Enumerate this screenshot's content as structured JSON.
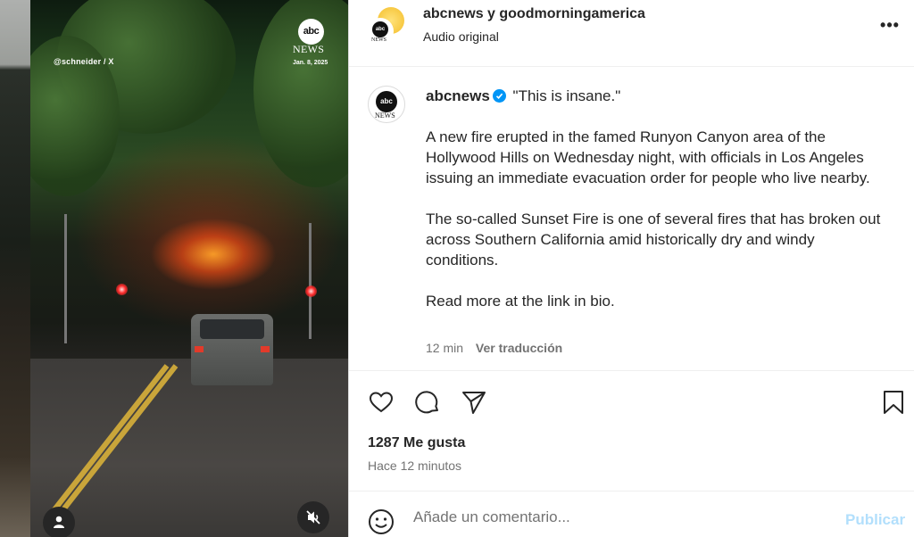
{
  "media": {
    "credit": "@schneider / X",
    "logo_abc": "abc",
    "logo_news": "NEWS",
    "date": "Jan. 8, 2025",
    "avatar_icon": "user-icon",
    "mute_icon": "mute-icon"
  },
  "header": {
    "logo_abc": "abc",
    "logo_news": "NEWS",
    "users": "abcnews y goodmorningamerica",
    "audio": "Audio original",
    "more": "•••",
    "more_icon": "more-options-icon"
  },
  "caption": {
    "logo_abc": "abc",
    "logo_news": "NEWS",
    "username": "abcnews",
    "verified_icon": "verified-badge-icon",
    "headline": "\"This is insane.\"",
    "paragraph1": "A new fire erupted in the famed Runyon Canyon area of the Hollywood Hills on Wednesday night, with officials in Los Angeles issuing an immediate evacuation order for people who live nearby.",
    "paragraph2": "The so-called Sunset Fire is one of several fires that has broken out across Southern California amid historically dry and windy conditions.",
    "paragraph3": "Read more at the link in bio.",
    "time": "12 min",
    "translate": "Ver traducción"
  },
  "actions": {
    "like_icon": "heart-icon",
    "comment_icon": "comment-icon",
    "share_icon": "share-icon",
    "save_icon": "bookmark-icon"
  },
  "stats": {
    "likes": "1287 Me gusta",
    "posted": "Hace 12 minutos"
  },
  "comment": {
    "emoji_icon": "emoji-icon",
    "placeholder": "Añade un comentario...",
    "value": "",
    "publish": "Publicar"
  },
  "colors": {
    "link_blue": "#0095f6",
    "publish_disabled": "#b2dffc",
    "secondary_text": "#737373"
  }
}
